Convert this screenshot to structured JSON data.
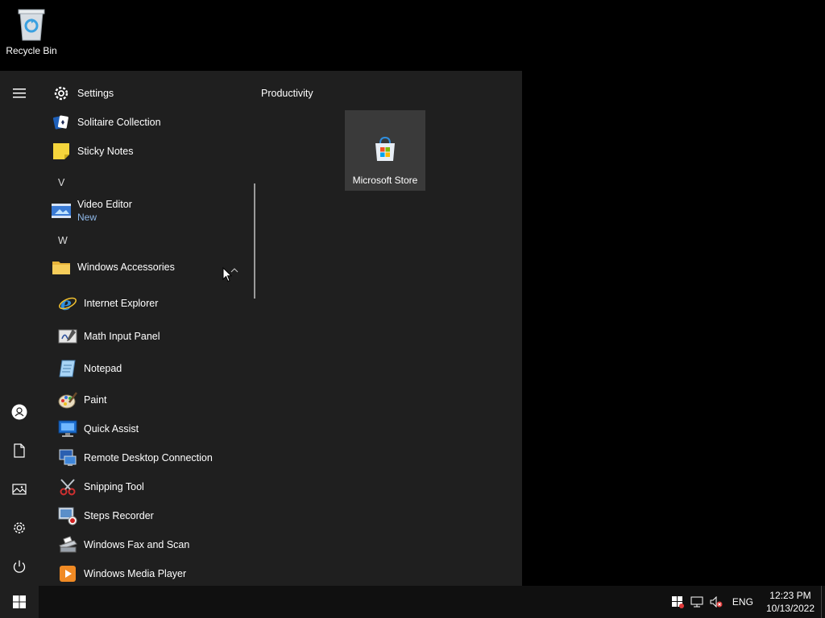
{
  "desktop": {
    "recycle_bin_label": "Recycle Bin"
  },
  "start_menu": {
    "rail": [
      {
        "icon": "hamburger-icon"
      },
      {
        "icon": "user-icon"
      },
      {
        "icon": "documents-icon"
      },
      {
        "icon": "pictures-icon"
      },
      {
        "icon": "settings-icon"
      },
      {
        "icon": "power-icon"
      }
    ],
    "apps": {
      "settings": "Settings",
      "solitaire": "Solitaire Collection",
      "sticky_notes": "Sticky Notes",
      "letter_v": "V",
      "video_editor": "Video Editor",
      "video_editor_badge": "New",
      "letter_w": "W",
      "windows_accessories": "Windows Accessories",
      "internet_explorer": "Internet Explorer",
      "math_input_panel": "Math Input Panel",
      "notepad": "Notepad",
      "paint": "Paint",
      "quick_assist": "Quick Assist",
      "remote_desktop": "Remote Desktop Connection",
      "snipping_tool": "Snipping Tool",
      "steps_recorder": "Steps Recorder",
      "fax_scan": "Windows Fax and Scan",
      "media_player": "Windows Media Player"
    },
    "tiles": {
      "group_title": "Productivity",
      "microsoft_store": "Microsoft Store"
    }
  },
  "taskbar": {
    "language": "ENG",
    "time": "12:23 PM",
    "date": "10/13/2022"
  },
  "colors": {
    "menu_bg": "#1f1f1f",
    "taskbar_bg": "#101010",
    "accent_sub": "#8fb8e8",
    "tile_bg": "#3a3a3a"
  }
}
